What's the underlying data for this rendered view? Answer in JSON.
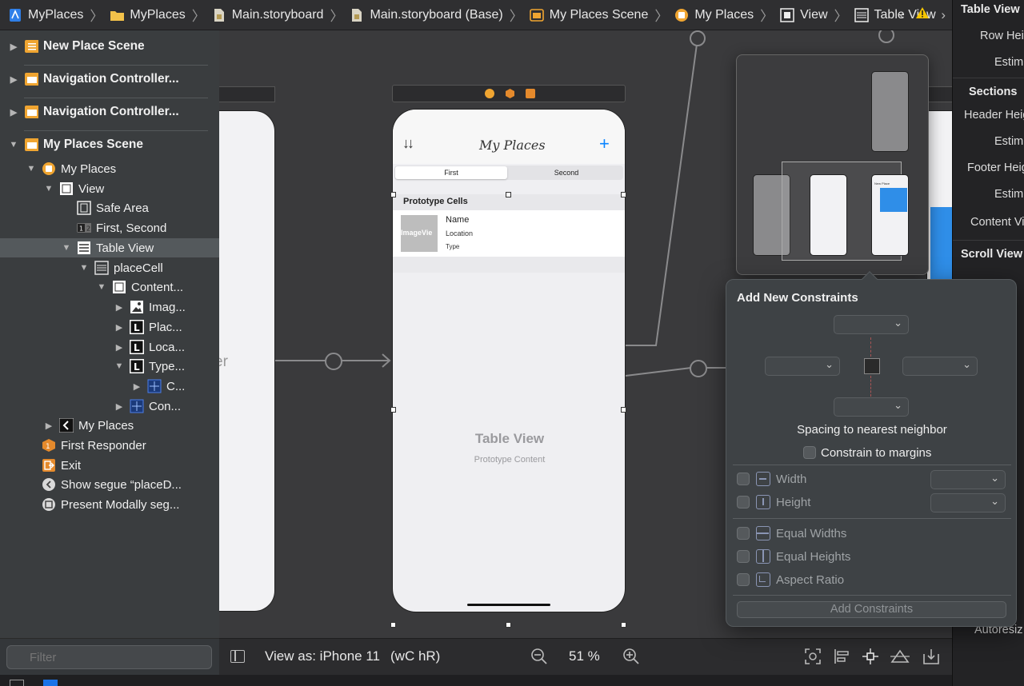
{
  "breadcrumb": {
    "items": [
      "MyPlaces",
      "MyPlaces",
      "Main.storyboard",
      "Main.storyboard (Base)",
      "My Places Scene",
      "My Places",
      "View",
      "Table View"
    ]
  },
  "navigator": {
    "rows": [
      {
        "label": "New Place Scene"
      },
      {
        "label": "Navigation Controller..."
      },
      {
        "label": "Navigation Controller..."
      },
      {
        "label": "My Places Scene"
      },
      {
        "label": "My Places"
      },
      {
        "label": "View"
      },
      {
        "label": "Safe Area"
      },
      {
        "label": "First, Second"
      },
      {
        "label": "Table View"
      },
      {
        "label": "placeCell"
      },
      {
        "label": "Content..."
      },
      {
        "label": "Imag..."
      },
      {
        "label": "Plac..."
      },
      {
        "label": "Loca..."
      },
      {
        "label": "Type..."
      },
      {
        "label": "C..."
      },
      {
        "label": "Con..."
      },
      {
        "label": "My Places"
      },
      {
        "label": "First Responder"
      },
      {
        "label": "Exit"
      },
      {
        "label": "Show segue “placeD..."
      },
      {
        "label": "Present Modally seg..."
      }
    ],
    "filter_placeholder": "Filter"
  },
  "canvas": {
    "left_partial_text": "er",
    "phone": {
      "nav_title": "My Places",
      "sort_glyph": "↓↓",
      "add_glyph": "+",
      "segments": [
        "First",
        "Second"
      ],
      "section_header": "Prototype Cells",
      "cell_image_text": "ImageVie",
      "cell_name": "Name",
      "cell_location": "Location",
      "cell_type": "Type",
      "placeholder_title": "Table View",
      "placeholder_sub": "Prototype Content"
    },
    "minimap_labels": [
      "New Place"
    ]
  },
  "canvas_bar": {
    "view_as": "View as: iPhone 11",
    "traits": "(wC hR)",
    "zoom": "51 %"
  },
  "inspector": {
    "items": [
      {
        "text": "Table View",
        "head": true
      },
      {
        "text": "Row Heig",
        "head": false
      },
      {
        "text": "Estim",
        "head": false
      },
      {
        "text": "Sections",
        "head": true
      },
      {
        "text": "Header Heig",
        "head": false
      },
      {
        "text": "Estim",
        "head": false
      },
      {
        "text": "Footer Heig",
        "head": false
      },
      {
        "text": "Estim",
        "head": false
      },
      {
        "text": "Content Vi",
        "head": false
      },
      {
        "text": "Scroll View",
        "head": true
      },
      {
        "text": "Autoresiz",
        "head": false
      }
    ]
  },
  "constraints": {
    "title": "Add New Constraints",
    "spacing_label": "Spacing to nearest neighbor",
    "margins_label": "Constrain to margins",
    "options": [
      "Width",
      "Height",
      "Equal Widths",
      "Equal Heights",
      "Aspect Ratio"
    ],
    "add_button": "Add Constraints"
  },
  "colors": {
    "accent_blue": "#0a84ff",
    "warning_yellow": "#f5c400",
    "scene_icon_orange": "#f0a531"
  }
}
